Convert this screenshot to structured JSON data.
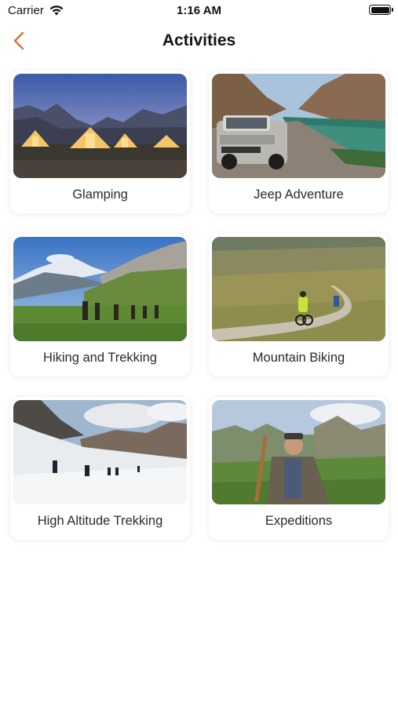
{
  "status_bar": {
    "carrier": "Carrier",
    "time": "1:16 AM",
    "wifi_icon": "wifi-icon",
    "battery_icon": "battery-icon"
  },
  "header": {
    "title": "Activities",
    "back_icon": "chevron-left-icon",
    "accent_color": "#D8773A"
  },
  "activities": [
    {
      "label": "Glamping",
      "image": "glamping-photo"
    },
    {
      "label": "Jeep Adventure",
      "image": "jeep-adventure-photo"
    },
    {
      "label": "Hiking and Trekking",
      "image": "hiking-trekking-photo"
    },
    {
      "label": "Mountain Biking",
      "image": "mountain-biking-photo"
    },
    {
      "label": "High Altitude Trekking",
      "image": "high-altitude-trekking-photo"
    },
    {
      "label": "Expeditions",
      "image": "expeditions-photo"
    }
  ]
}
